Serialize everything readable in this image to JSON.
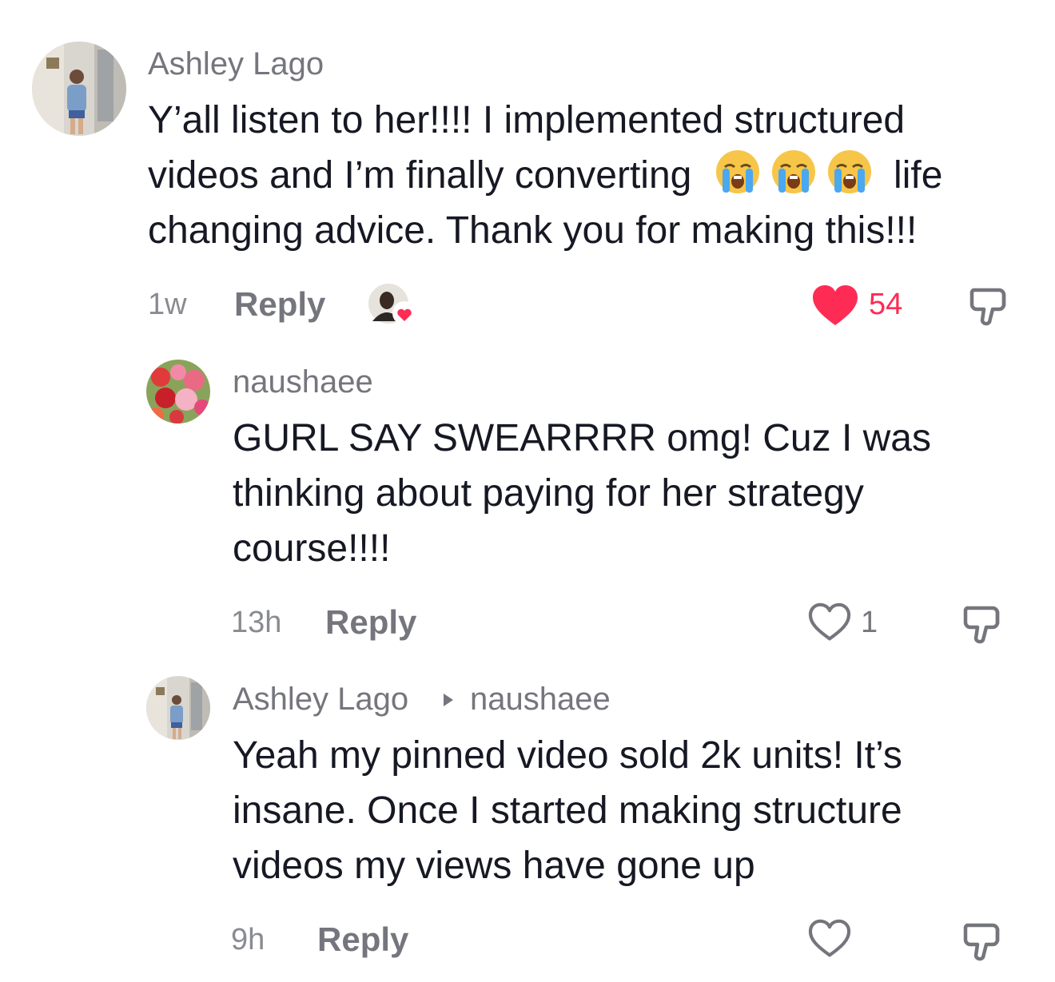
{
  "comments": [
    {
      "username": "Ashley Lago",
      "lines": [
        "Y’all listen to her!!!! I implemented structured",
        "videos and I’m finally converting",
        "life",
        "changing advice. Thank you for making this!!!"
      ],
      "emojis": [
        "loudly-crying-face-icon",
        "loudly-crying-face-icon",
        "loudly-crying-face-icon"
      ],
      "time": "1w",
      "reply_label": "Reply",
      "likes": "54",
      "liked": true,
      "creator_liked": true
    },
    {
      "username": "naushaee",
      "lines": [
        "GURL SAY SWEARRRR omg! Cuz I was",
        "thinking about paying for her strategy",
        "course!!!!"
      ],
      "time": "13h",
      "reply_label": "Reply",
      "likes": "1",
      "liked": false
    },
    {
      "username": "Ashley Lago",
      "reply_to": "naushaee",
      "lines": [
        "Yeah my pinned video sold 2k units! It’s",
        "insane. Once I started making structure",
        "videos my views have gone up"
      ],
      "time": "9h",
      "reply_label": "Reply",
      "likes": "",
      "liked": false
    }
  ],
  "colors": {
    "like_red": "#fe2c55",
    "text_primary": "#161823",
    "text_secondary": "#75767d"
  }
}
